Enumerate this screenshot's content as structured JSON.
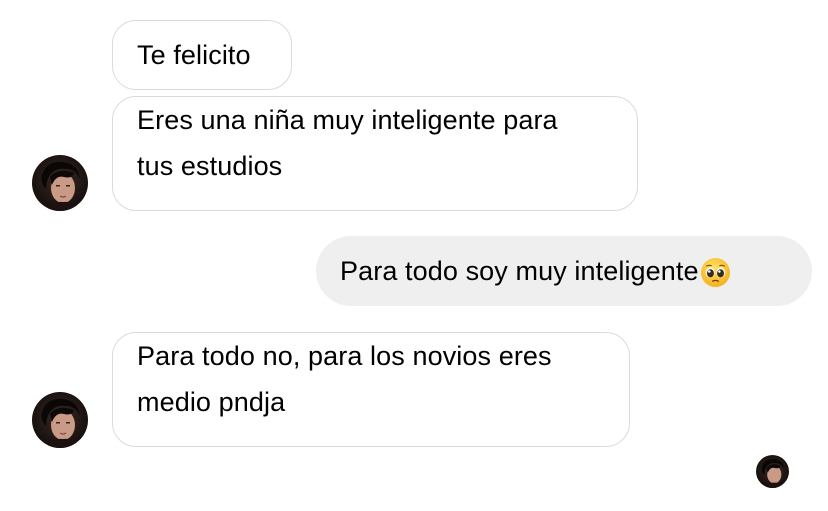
{
  "messages": [
    {
      "direction": "received",
      "lines": [
        "Te felicito"
      ]
    },
    {
      "direction": "received",
      "lines": [
        "Eres una niña muy inteligente para",
        "tus estudios"
      ]
    },
    {
      "direction": "sent",
      "text": "Para todo soy muy inteligente",
      "emoji": "pleading-face-icon"
    },
    {
      "direction": "received",
      "lines": [
        "Para todo no, para los novios eres",
        "medio pndja"
      ]
    }
  ],
  "avatars": [
    {
      "icon": "contact-avatar"
    },
    {
      "icon": "contact-avatar"
    },
    {
      "icon": "seen-receipt-avatar"
    }
  ],
  "colors": {
    "received_bubble_bg": "#ffffff",
    "received_bubble_border": "#dbdbdb",
    "sent_bubble_bg": "#efefef",
    "text": "#000000",
    "emoji_face": "#fcc21b"
  }
}
